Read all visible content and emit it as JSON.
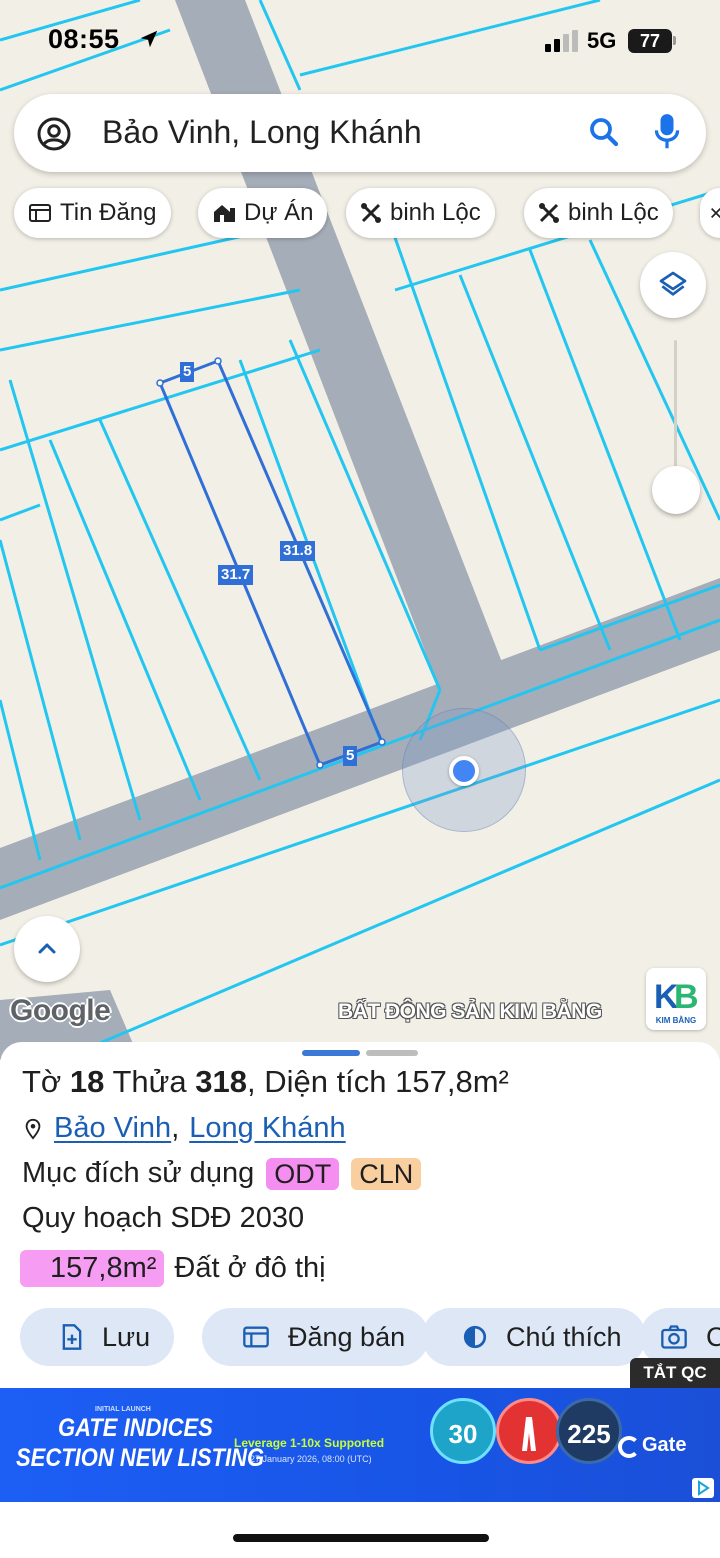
{
  "status_bar": {
    "time": "08:55",
    "network": "5G",
    "battery": "77"
  },
  "search": {
    "text": "Bảo Vinh, Long Khánh"
  },
  "chips": [
    {
      "label": "Tin Đăng",
      "icon": "listing-icon"
    },
    {
      "label": "Dự Án",
      "icon": "project-icon"
    },
    {
      "label": "binh Lộc",
      "icon": "tools-icon"
    },
    {
      "label": "binh Lộc",
      "icon": "tools-icon"
    }
  ],
  "map": {
    "parcel_labels": {
      "top": "5",
      "bottom": "5",
      "left": "31.7",
      "right": "31.8"
    },
    "google": "Google",
    "watermark": "BẤT ĐỘNG SẢN KIM BẰNG",
    "logo_text": "KIM BẰNG"
  },
  "sheet": {
    "to_label": "Tờ",
    "to_value": "18",
    "thua_label": "Thửa",
    "thua_value": "318",
    "area_label": ", Diện tích",
    "area_value": "157,8m²",
    "ward": "Bảo Vinh",
    "separator": ",",
    "city": "Long Khánh",
    "purpose_label": "Mục đích sử dụng",
    "tag_odt": "ODT",
    "tag_cln": "CLN",
    "plan": "Quy hoạch SDĐ 2030",
    "plan_area": "157,8m²",
    "plan_type": "Đất ở đô thị",
    "actions": [
      {
        "label": "Lưu",
        "icon": "add-doc-icon"
      },
      {
        "label": "Đăng bán",
        "icon": "calendar-icon"
      },
      {
        "label": "Chú thích",
        "icon": "contrast-icon"
      },
      {
        "label": "C",
        "icon": "camera-icon"
      }
    ]
  },
  "ad": {
    "close_label": "TẮT QC",
    "small": "INITIAL LAUNCH",
    "title_line1": "GATE INDICES",
    "title_line2": "SECTION NEW LISTING",
    "leverage": "Leverage 1-10x Supported",
    "date": "27 January 2026, 08:00 (UTC)",
    "coin1": "30",
    "coin3": "225",
    "brand": "Gate"
  }
}
